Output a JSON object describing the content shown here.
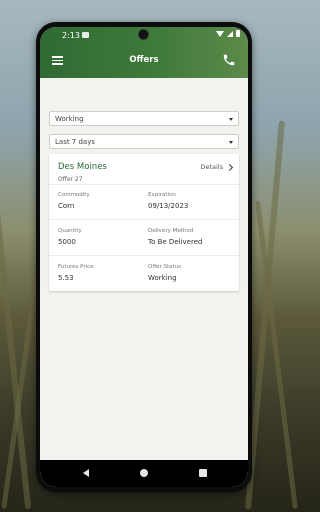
{
  "status_bar": {
    "time": "2:13"
  },
  "app_bar": {
    "title": "Offers"
  },
  "filters": {
    "status_select": "Working",
    "date_select": "Last 7 days"
  },
  "offer_card": {
    "location": "Des Moines",
    "offer_number": "Offer 27",
    "details_label": "Details",
    "fields": {
      "commodity_label": "Commodity",
      "commodity_value": "Corn",
      "expiration_label": "Expiration",
      "expiration_value": "09/13/2023",
      "quantity_label": "Quantity",
      "quantity_value": "5000",
      "delivery_method_label": "Delivery Method",
      "delivery_method_value": "To Be Delivered",
      "futures_price_label": "Futures Price",
      "futures_price_value": "5.53",
      "offer_status_label": "Offer Status",
      "offer_status_value": "Working"
    }
  },
  "colors": {
    "app_bar_green": "#2f6a33",
    "location_green": "#2c6a35",
    "screen_background": "#f2f2ee"
  }
}
